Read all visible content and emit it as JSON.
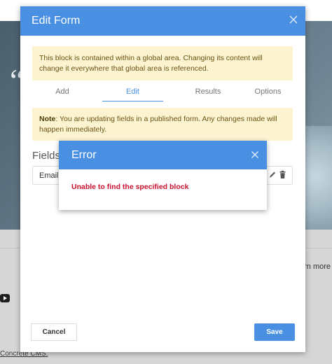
{
  "background": {
    "learn_more": "arn more",
    "cms_link": "Concrete CMS",
    "cms_suffix": "."
  },
  "modal": {
    "title": "Edit Form",
    "global_alert": "This block is contained within a global area. Changing its content will change it everywhere that global area is referenced.",
    "tabs": [
      {
        "label": "Add",
        "active": false
      },
      {
        "label": "Edit",
        "active": true
      },
      {
        "label": "Results",
        "active": false
      },
      {
        "label": "Options",
        "active": false
      }
    ],
    "note_label": "Note",
    "note_text": ": You are updating fields in a published form. Any changes made will happen immediately.",
    "fields_heading": "Fields",
    "field_row_label": "Email A",
    "cancel_label": "Cancel",
    "save_label": "Save"
  },
  "error_dialog": {
    "title": "Error",
    "message": "Unable to find the specified block"
  },
  "colors": {
    "primary": "#4a90e2",
    "warning_bg": "#fcf4d0",
    "error_text": "#c8102e"
  },
  "icons": {
    "modal_close": "close-icon",
    "error_close": "close-icon",
    "field_move": "move-icon",
    "field_edit": "pencil-icon",
    "field_delete": "trash-icon",
    "video": "youtube-icon"
  }
}
